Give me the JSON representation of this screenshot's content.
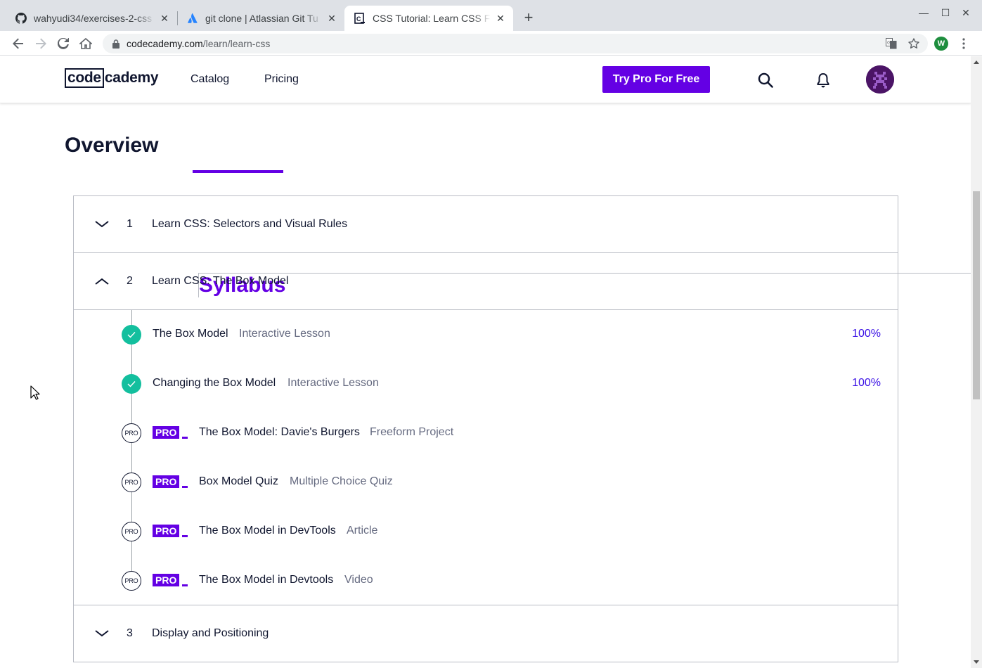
{
  "browser": {
    "tabs": [
      {
        "title": "wahyudi34/exercises-2-css",
        "icon": "github-icon",
        "active": false
      },
      {
        "title": "git clone | Atlassian Git Tu",
        "icon": "atlassian-icon",
        "active": false
      },
      {
        "title": "CSS Tutorial: Learn CSS Fo",
        "icon": "codecademy-icon",
        "active": true
      }
    ],
    "url_host": "codecademy.com",
    "url_path": "/learn/learn-css",
    "profile_initial": "W"
  },
  "header": {
    "logo_boxed": "code",
    "logo_rest": "cademy",
    "nav": [
      "Catalog",
      "Pricing"
    ],
    "cta": "Try Pro For Free"
  },
  "page_tabs": {
    "overview": "Overview",
    "syllabus": "Syllabus",
    "active": "syllabus"
  },
  "modules": [
    {
      "num": "1",
      "title": "Learn CSS: Selectors and Visual Rules",
      "expanded": false
    },
    {
      "num": "2",
      "title": "Learn CSS: The Box Model",
      "expanded": true
    },
    {
      "num": "3",
      "title": "Display and Positioning",
      "expanded": false
    }
  ],
  "lessons": [
    {
      "name": "The Box Model",
      "type": "Interactive Lesson",
      "status": "done",
      "progress": "100%",
      "pro": false
    },
    {
      "name": "Changing the Box Model",
      "type": "Interactive Lesson",
      "status": "done",
      "progress": "100%",
      "pro": false
    },
    {
      "name": "The Box Model: Davie's Burgers",
      "type": "Freeform Project",
      "status": "pro",
      "progress": "",
      "pro": true
    },
    {
      "name": "Box Model Quiz",
      "type": "Multiple Choice Quiz",
      "status": "pro",
      "progress": "",
      "pro": true
    },
    {
      "name": "The Box Model in DevTools",
      "type": "Article",
      "status": "pro",
      "progress": "",
      "pro": true
    },
    {
      "name": "The Box Model in Devtools",
      "type": "Video",
      "status": "pro",
      "progress": "",
      "pro": true
    }
  ],
  "pro_label": "PRO",
  "status_pro_label": "PRO",
  "colors": {
    "brand_purple": "#6400e4",
    "complete_teal": "#13bf9e",
    "progress_blue": "#3a10e5",
    "navy": "#10162f"
  }
}
